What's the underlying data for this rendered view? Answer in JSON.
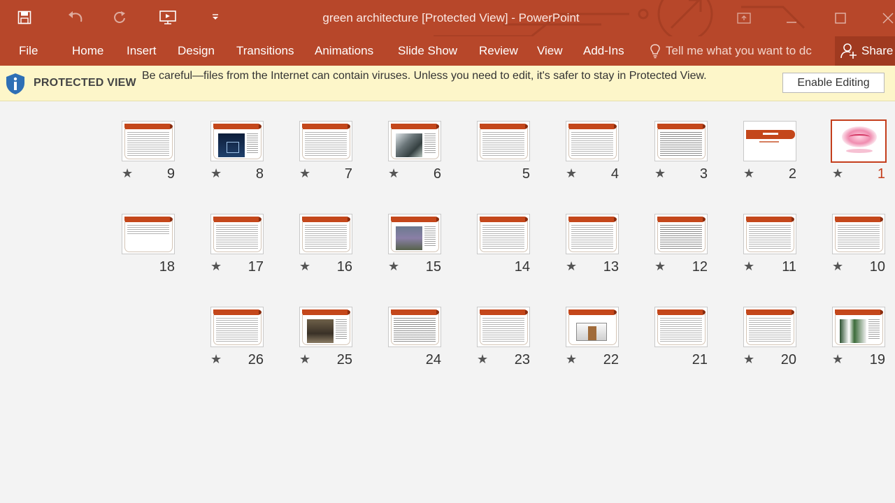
{
  "window": {
    "title": "green architecture [Protected View] - PowerPoint",
    "controls": [
      "minimize-icon",
      "restore-icon",
      "close-icon"
    ]
  },
  "ribbon": {
    "tabs": [
      {
        "id": "file",
        "label": "File"
      },
      {
        "id": "home",
        "label": "Home"
      },
      {
        "id": "insert",
        "label": "Insert"
      },
      {
        "id": "design",
        "label": "Design"
      },
      {
        "id": "transitions",
        "label": "Transitions"
      },
      {
        "id": "animations",
        "label": "Animations"
      },
      {
        "id": "slide-show",
        "label": "Slide Show"
      },
      {
        "id": "review",
        "label": "Review"
      },
      {
        "id": "view",
        "label": "View"
      },
      {
        "id": "add-ins",
        "label": "Add-Ins"
      }
    ],
    "tell_me": "Tell me what you want to dc",
    "share": "Share"
  },
  "protected_view": {
    "label": "PROTECTED VIEW",
    "message": "Be careful—files from the Internet can contain viruses. Unless you need to edit, it's safer to stay in Protected View.",
    "button": "Enable Editing"
  },
  "slides": [
    {
      "number": "1",
      "animated": true,
      "selected": true,
      "layout": "calligraphy"
    },
    {
      "number": "2",
      "animated": true,
      "layout": "titlebox"
    },
    {
      "number": "3",
      "animated": true,
      "layout": "dense"
    },
    {
      "number": "4",
      "animated": true,
      "layout": "text"
    },
    {
      "number": "5",
      "animated": false,
      "layout": "text"
    },
    {
      "number": "6",
      "animated": true,
      "layout": "photo-roof"
    },
    {
      "number": "7",
      "animated": true,
      "layout": "text"
    },
    {
      "number": "8",
      "animated": true,
      "layout": "photo-night"
    },
    {
      "number": "9",
      "animated": true,
      "layout": "text"
    },
    {
      "number": "10",
      "animated": true,
      "layout": "text"
    },
    {
      "number": "11",
      "animated": true,
      "layout": "text"
    },
    {
      "number": "12",
      "animated": true,
      "layout": "dense"
    },
    {
      "number": "13",
      "animated": true,
      "layout": "text"
    },
    {
      "number": "14",
      "animated": false,
      "layout": "text"
    },
    {
      "number": "15",
      "animated": true,
      "layout": "photo-trees"
    },
    {
      "number": "16",
      "animated": true,
      "layout": "text"
    },
    {
      "number": "17",
      "animated": true,
      "layout": "text"
    },
    {
      "number": "18",
      "animated": false,
      "layout": "short"
    },
    {
      "number": "19",
      "animated": true,
      "layout": "photo-plants"
    },
    {
      "number": "20",
      "animated": true,
      "layout": "text"
    },
    {
      "number": "21",
      "animated": false,
      "layout": "text"
    },
    {
      "number": "22",
      "animated": true,
      "layout": "house"
    },
    {
      "number": "23",
      "animated": true,
      "layout": "text"
    },
    {
      "number": "24",
      "animated": false,
      "layout": "dense"
    },
    {
      "number": "25",
      "animated": true,
      "layout": "photo-court"
    },
    {
      "number": "26",
      "animated": true,
      "layout": "text"
    }
  ],
  "star_glyph": "★",
  "colors": {
    "accent": "#b7472a",
    "selected": "#c43e1c",
    "warning_bar": "#fdf6c9"
  }
}
